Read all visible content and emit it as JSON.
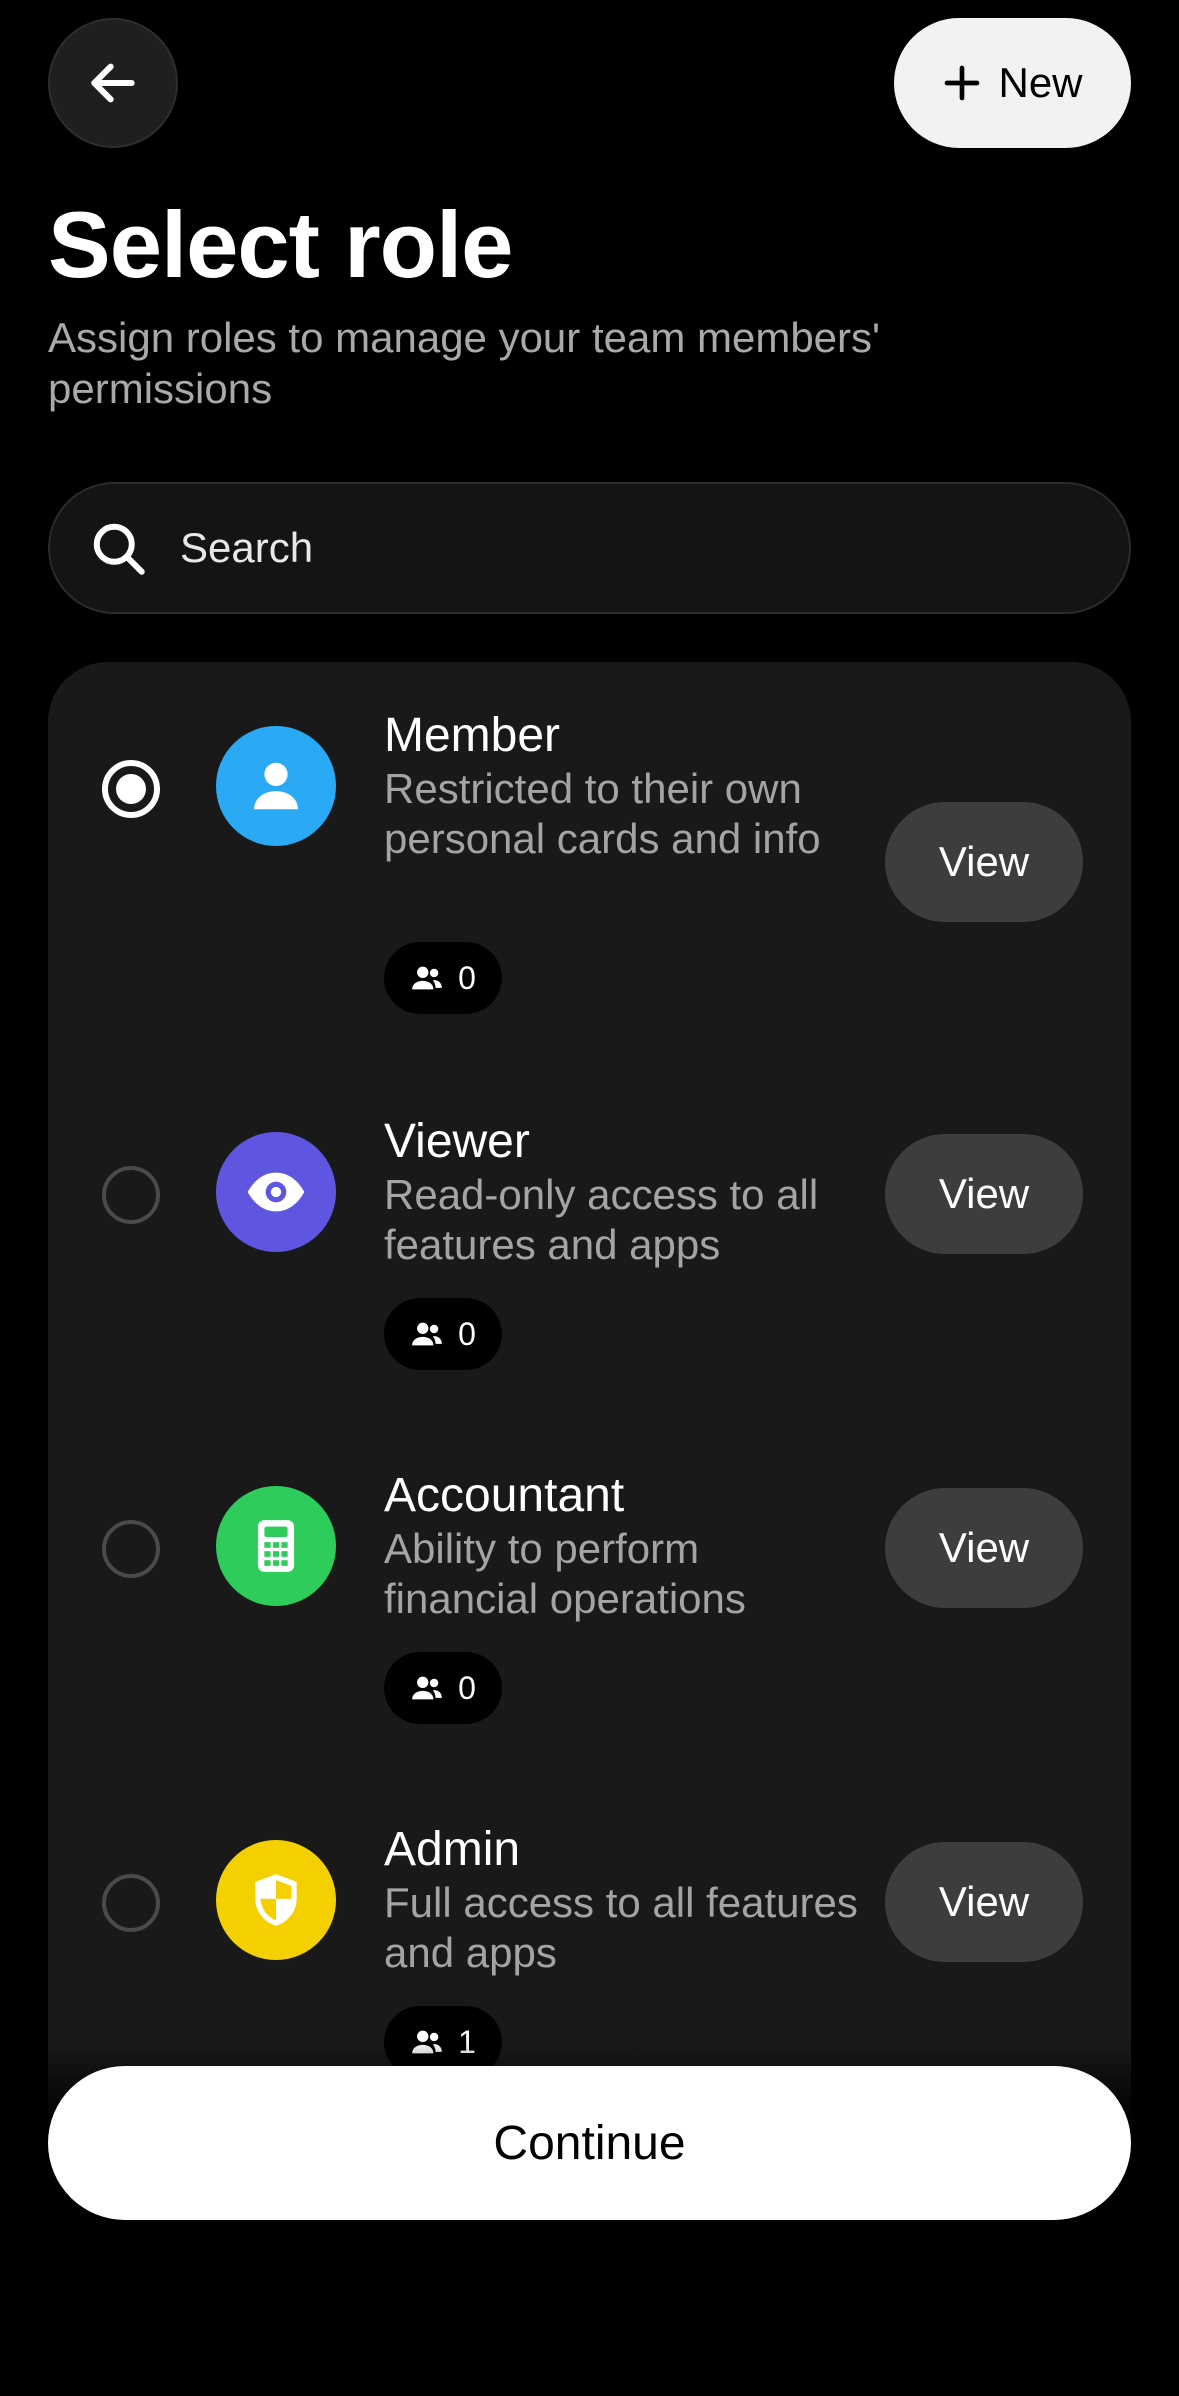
{
  "header": {
    "back_icon": "arrow-left-icon",
    "new_label": "New",
    "new_icon": "plus-icon"
  },
  "page": {
    "title": "Select role",
    "subtitle": "Assign roles to manage your team members' permissions"
  },
  "search": {
    "placeholder": "Search",
    "icon": "search-icon"
  },
  "roles": [
    {
      "name": "Member",
      "description": "Restricted to their own personal cards and info",
      "count": "0",
      "selected": true,
      "icon": "person-icon",
      "color": "#2AAAF4",
      "view_label": "View"
    },
    {
      "name": "Viewer",
      "description": "Read-only access to all features and apps",
      "count": "0",
      "selected": false,
      "icon": "eye-icon",
      "color": "#5E55E0",
      "view_label": "View"
    },
    {
      "name": "Accountant",
      "description": "Ability to perform financial operations",
      "count": "0",
      "selected": false,
      "icon": "calculator-icon",
      "color": "#2ECC5B",
      "view_label": "View"
    },
    {
      "name": "Admin",
      "description": "Full access to all features and apps",
      "count": "1",
      "selected": false,
      "icon": "shield-icon",
      "color": "#F5D000",
      "view_label": "View"
    }
  ],
  "footer": {
    "continue_label": "Continue"
  }
}
